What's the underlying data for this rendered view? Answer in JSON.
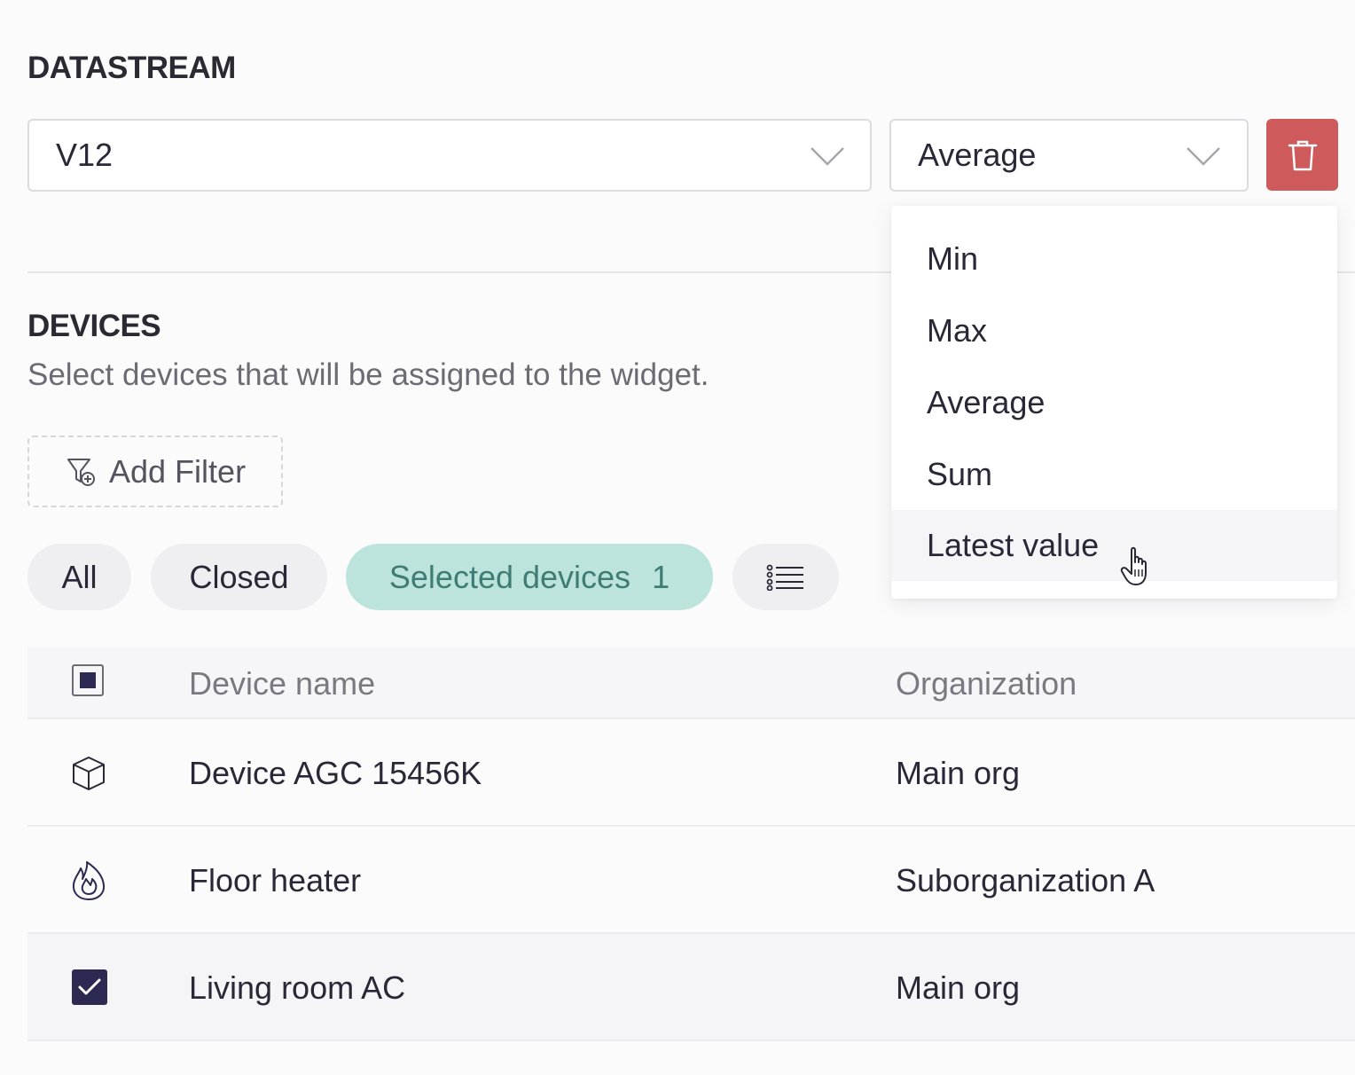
{
  "datastream": {
    "title": "DATASTREAM",
    "stream_value": "V12",
    "aggregation_value": "Average",
    "delete_icon": "trash-icon"
  },
  "aggregation_menu": {
    "items": [
      "Min",
      "Max",
      "Average",
      "Sum",
      "Latest value"
    ],
    "hovered": "Latest value"
  },
  "devices": {
    "title": "DEVICES",
    "description": "Select devices that will be assigned to the widget.",
    "add_filter_label": "Add Filter",
    "tabs": {
      "all": "All",
      "closed": "Closed",
      "selected": "Selected devices",
      "selected_count": "1"
    },
    "table": {
      "col_name": "Device name",
      "col_org": "Organization",
      "rows": [
        {
          "name": "Device AGC 15456K",
          "org": "Main org",
          "icon": "cube-icon",
          "checked": false
        },
        {
          "name": "Floor heater",
          "org": "Suborganization A",
          "icon": "flame-icon",
          "checked": false
        },
        {
          "name": "Living room AC",
          "org": "Main org",
          "icon": "checkbox-checked-icon",
          "checked": true
        }
      ]
    }
  },
  "colors": {
    "danger": "#cf5a5c",
    "active_tab_bg": "#bde4dc",
    "active_tab_text": "#3f7c74",
    "checkbox_dark": "#2c2a52"
  }
}
